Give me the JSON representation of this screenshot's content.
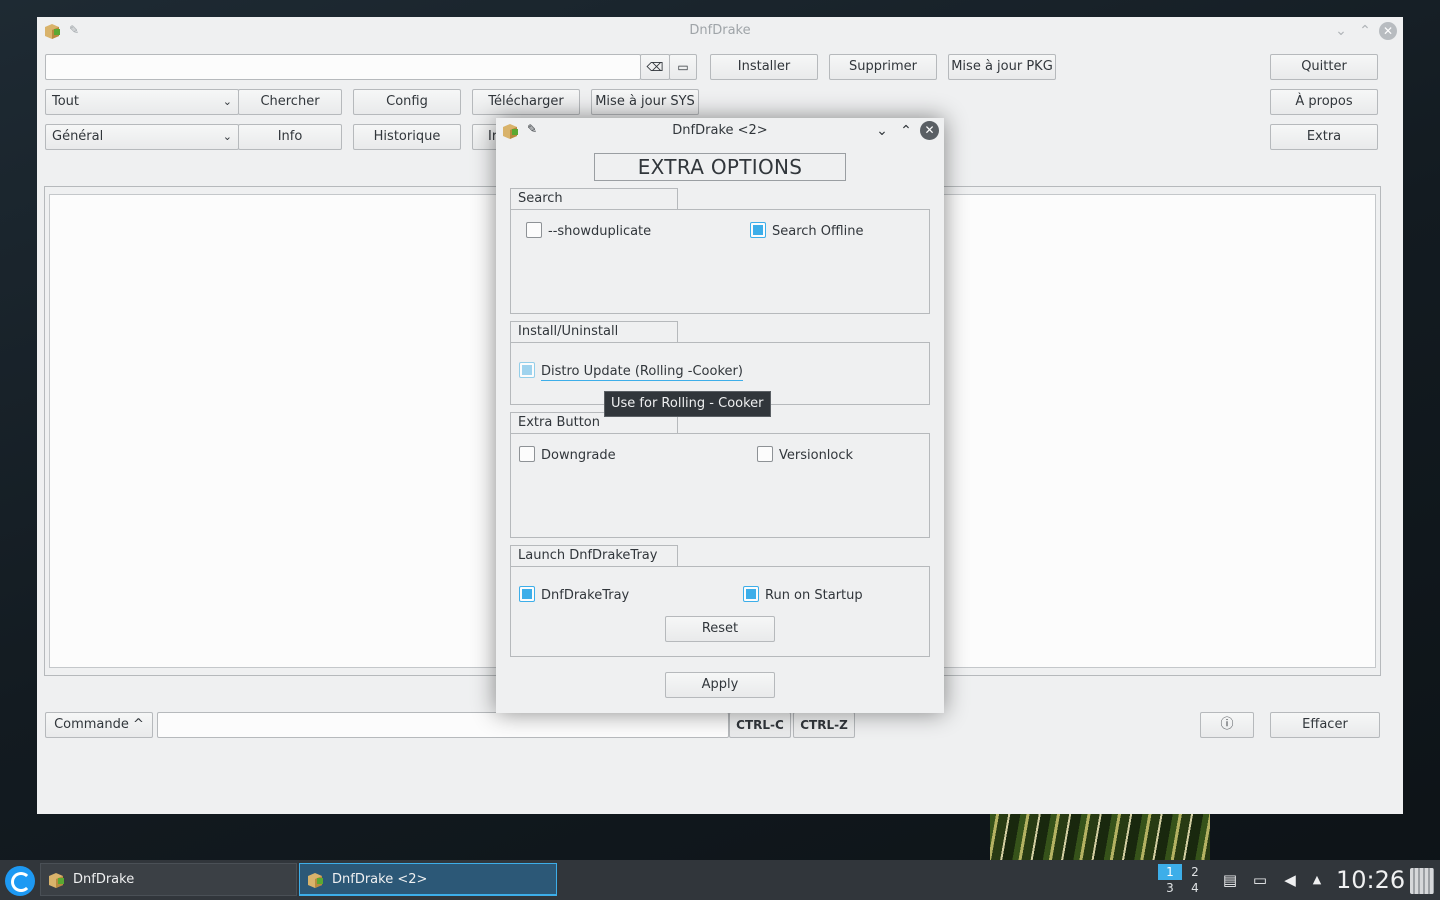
{
  "main_window": {
    "title": "DnfDrake",
    "search": {
      "value": "",
      "placeholder": ""
    },
    "buttons": {
      "install": "Installer",
      "remove": "Supprimer",
      "update_pkg": "Mise à jour PKG",
      "quit": "Quitter",
      "search": "Chercher",
      "config": "Config",
      "download": "Télécharger",
      "update_sys": "Mise à jour SYS",
      "about": "À propos",
      "info": "Info",
      "history": "Historique",
      "hidden_partial": "Ir",
      "extra": "Extra",
      "command": "Commande ^",
      "ctrl_c": "CTRL-C",
      "ctrl_z": "CTRL-Z",
      "info_icon": "ⓘ",
      "clear": "Effacer"
    },
    "filters": {
      "scope": "Tout",
      "category": "Général"
    },
    "command_input": {
      "value": ""
    }
  },
  "dialog": {
    "title": "DnfDrake <2>",
    "heading": "EXTRA OPTIONS",
    "groups": {
      "search": {
        "label": "Search",
        "options": {
          "showduplicate": "--showduplicate",
          "search_offline": "Search Offline"
        }
      },
      "install": {
        "label": "Install/Uninstall",
        "options": {
          "distro_update": "Distro Update (Rolling -Cooker)"
        }
      },
      "extra_button": {
        "label": "Extra Button",
        "options": {
          "downgrade": "Downgrade",
          "versionlock": "Versionlock"
        }
      },
      "tray": {
        "label": "Launch DnfDrakeTray",
        "options": {
          "dnfdraketray": "DnfDrakeTray",
          "run_on_startup": "Run on Startup"
        },
        "reset": "Reset"
      }
    },
    "apply": "Apply",
    "tooltip": "Use for Rolling - Cooker",
    "state": {
      "showduplicate": false,
      "search_offline": true,
      "distro_update": "partial",
      "downgrade": false,
      "versionlock": false,
      "dnfdraketray": true,
      "run_on_startup": true
    }
  },
  "taskbar": {
    "tasks": [
      "DnfDrake",
      "DnfDrake <2>"
    ],
    "pager": [
      "1",
      "2",
      "3",
      "4"
    ],
    "clock": "10:26"
  },
  "colors": {
    "accent": "#3daee9",
    "window_bg": "#eff0f1",
    "taskbar_bg": "#31363b",
    "tooltip_bg": "#31363b"
  }
}
